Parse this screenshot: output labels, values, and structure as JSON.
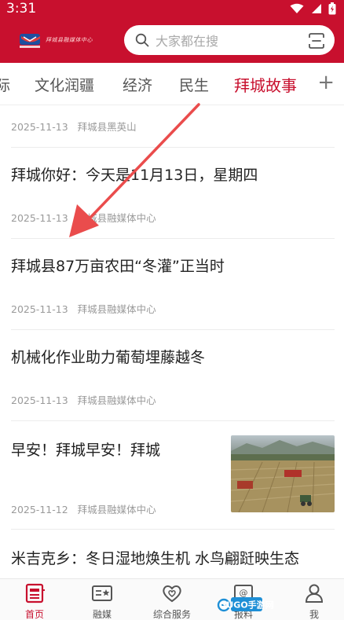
{
  "status_bar": {
    "time": "3:31"
  },
  "header": {
    "logo_text": "拜城县融媒体中心",
    "search_placeholder": "大家都在搜"
  },
  "tabs": [
    {
      "label": "际"
    },
    {
      "label": "文化润疆"
    },
    {
      "label": "经济"
    },
    {
      "label": "民生"
    },
    {
      "label": "拜城故事",
      "active": true
    }
  ],
  "tab_add_label": "+",
  "feed": {
    "items": [
      {
        "title": "",
        "date": "2025-11-13",
        "source": "拜城县黑英山"
      },
      {
        "title": "拜城你好：今天是11月13日，星期四",
        "date": "2025-11-13",
        "source": "拜城县融媒体中心"
      },
      {
        "title": "拜城县87万亩农田“冬灌”正当时",
        "date": "2025-11-13",
        "source": "拜城县融媒体中心"
      },
      {
        "title": "机械化作业助力葡萄埋藤越冬",
        "date": "2025-11-13",
        "source": "拜城县融媒体中心"
      },
      {
        "title": "早安！拜城早安！拜城",
        "date": "2025-11-12",
        "source": "拜城县融媒体中心",
        "has_image": true
      },
      {
        "title": "米吉克乡：冬日湿地焕生机 水鸟翩跹映生态",
        "date": "",
        "source": ""
      }
    ]
  },
  "bottom_nav": [
    {
      "label": "首页",
      "icon": "news-icon",
      "active": true
    },
    {
      "label": "融媒",
      "icon": "media-icon"
    },
    {
      "label": "综合服务",
      "icon": "heart-service-icon"
    },
    {
      "label": "报料",
      "icon": "report-icon"
    },
    {
      "label": "我",
      "icon": "user-icon"
    }
  ],
  "watermark_text": "GUGO手游网",
  "colors": {
    "brand_red": "#c8102e",
    "text_dark": "#222222",
    "text_meta": "#9a9a9a"
  }
}
